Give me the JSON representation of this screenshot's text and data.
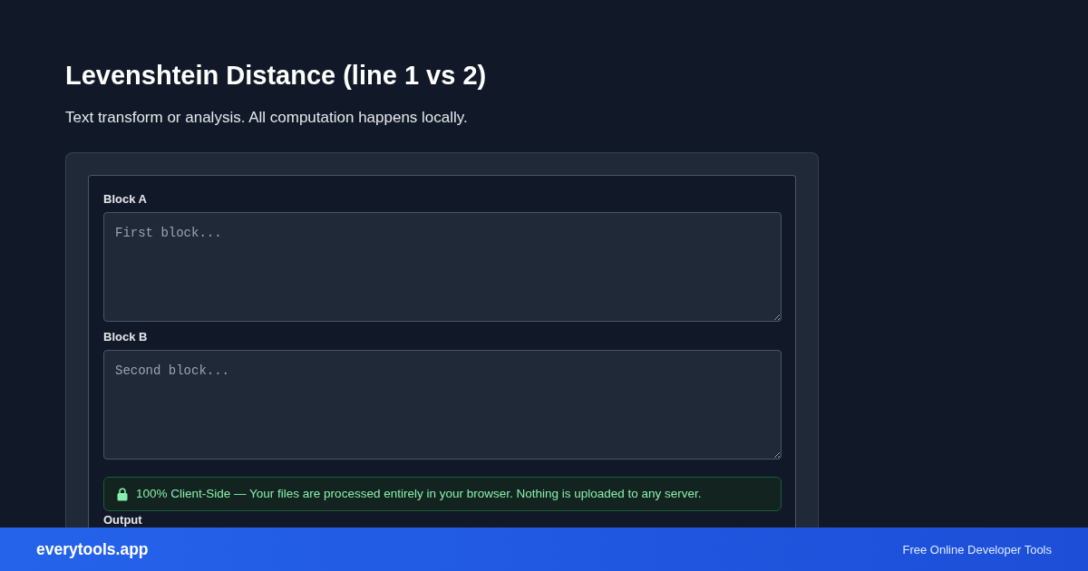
{
  "page": {
    "title": "Levenshtein Distance (line 1 vs 2)",
    "subtitle": "Text transform or analysis. All computation happens locally."
  },
  "tool": {
    "fields": [
      {
        "label": "Block A",
        "placeholder": "First block..."
      },
      {
        "label": "Block B",
        "placeholder": "Second block..."
      }
    ],
    "notice": {
      "text": "100% Client-Side — Your files are processed entirely in your browser. Nothing is uploaded to any server."
    },
    "output": {
      "label": "Output"
    }
  },
  "footer": {
    "brand": "everytools.app",
    "tagline": "Free Online Developer Tools"
  }
}
